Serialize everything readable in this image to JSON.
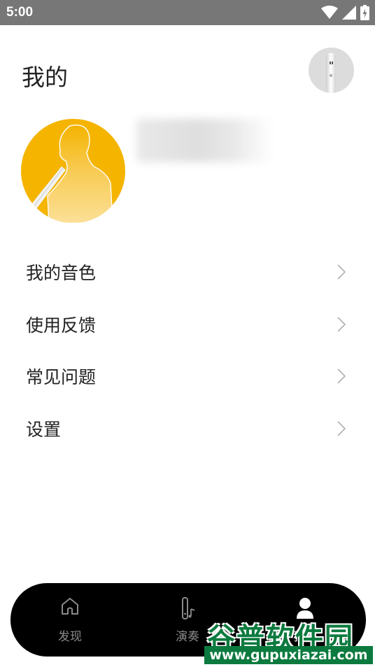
{
  "status_bar": {
    "time": "5:00",
    "icons": [
      "wifi-icon",
      "signal-icon",
      "battery-charging-icon"
    ]
  },
  "header": {
    "title": "我的",
    "device_icon": "flute-device-icon"
  },
  "profile": {
    "avatar_icon": "user-silhouette-with-flute",
    "username": ""
  },
  "menu": {
    "items": [
      {
        "label": "我的音色"
      },
      {
        "label": "使用反馈"
      },
      {
        "label": "常见问题"
      },
      {
        "label": "设置"
      }
    ]
  },
  "bottom_nav": {
    "tabs": [
      {
        "label": "发现",
        "icon": "home-icon"
      },
      {
        "label": "演奏",
        "icon": "instrument-icon"
      },
      {
        "label": "我的",
        "icon": "person-icon",
        "active": true
      }
    ]
  },
  "watermark": {
    "main": "谷普软件园",
    "url": "www.gupuxiazai.com"
  },
  "colors": {
    "status_bar": "#777777",
    "avatar_bg": "#f4b400",
    "nav_bg": "#000000",
    "watermark": "#0b7a3e"
  }
}
